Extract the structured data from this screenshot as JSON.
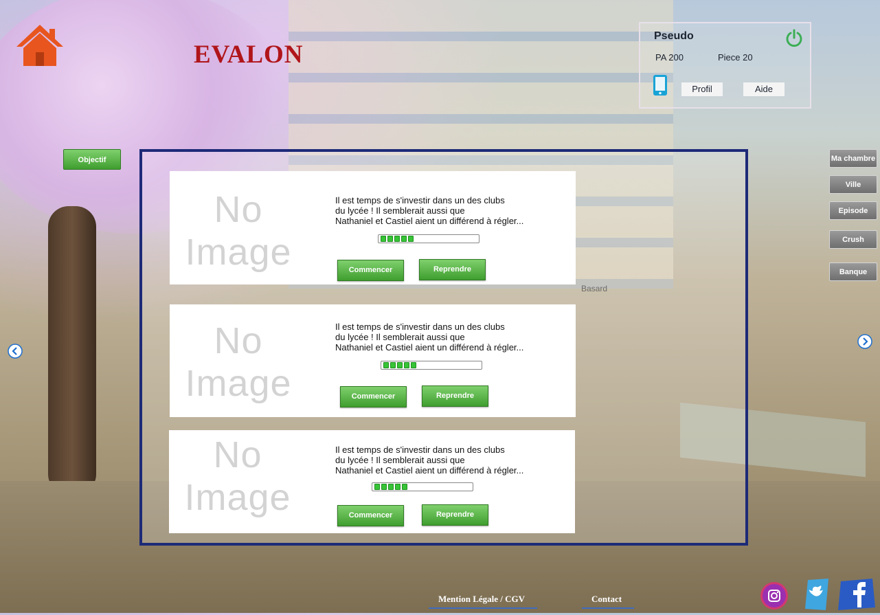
{
  "header": {
    "logo": "EVALON",
    "home_icon": "home-icon"
  },
  "user_panel": {
    "pseudo": "Pseudo",
    "pa": "PA 200",
    "piece": "Piece 20",
    "profil_label": "Profil",
    "aide_label": "Aide",
    "power_icon": "power-icon",
    "phone_icon": "phone-icon"
  },
  "objectif_label": "Objectif",
  "side_nav": [
    {
      "label": "Ma chambre"
    },
    {
      "label": "Ville"
    },
    {
      "label": "Episode"
    },
    {
      "label": "Crush"
    },
    {
      "label": "Banque"
    }
  ],
  "basard_label": "Basard",
  "no_image_text": "No Image",
  "episodes": [
    {
      "desc1": "Il est temps de s'investir dans un des clubs",
      "desc2": "du lycée ! Il semblerait aussi que",
      "desc3": "Nathaniel et Castiel aient un différend à régler...",
      "progress_dots": 5,
      "start_label": "Commencer",
      "resume_label": "Reprendre"
    },
    {
      "desc1": "Il est temps de s'investir dans un des clubs",
      "desc2": "du lycée ! Il semblerait aussi que",
      "desc3": "Nathaniel et Castiel aient un différend à régler...",
      "progress_dots": 5,
      "start_label": "Commencer",
      "resume_label": "Reprendre"
    },
    {
      "desc1": "Il est temps de s'investir dans un des clubs",
      "desc2": "du lycée ! Il semblerait aussi que",
      "desc3": "Nathaniel et Castiel aient un différend à régler...",
      "progress_dots": 5,
      "start_label": "Commencer",
      "resume_label": "Reprendre"
    }
  ],
  "footer": {
    "legal": "Mention Légale / CGV",
    "contact": "Contact"
  },
  "social": [
    "instagram-icon",
    "twitter-icon",
    "facebook-icon"
  ],
  "colors": {
    "brand_red": "#b0151a",
    "frame_blue": "#1d2a78",
    "button_green": "#3f9e2f",
    "nav_gray": "#6f6f6f"
  }
}
